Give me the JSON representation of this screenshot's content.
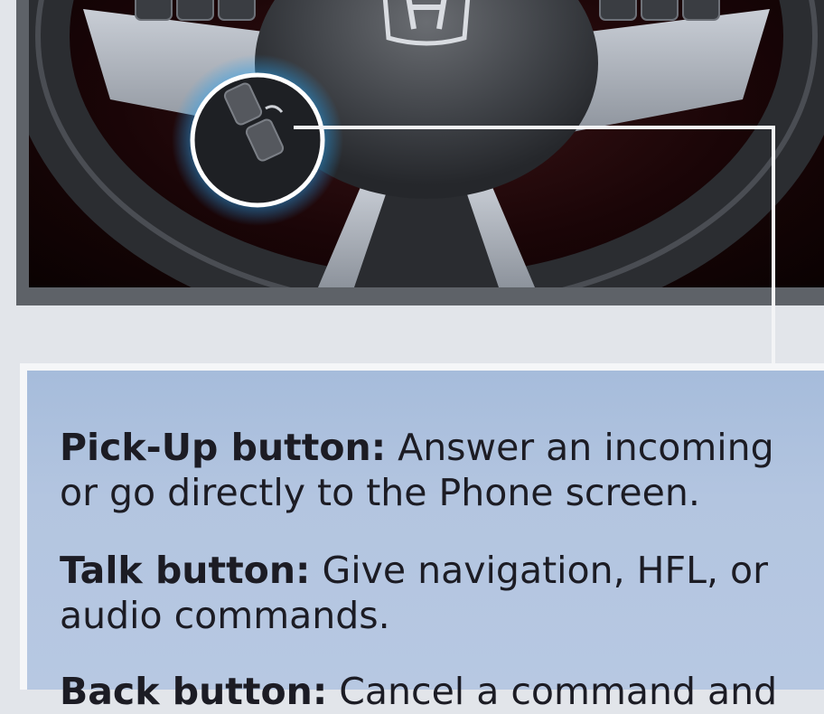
{
  "descriptions": [
    {
      "term": "Pick-Up button:",
      "line1": "Answer an incoming",
      "line2": "or go directly to the Phone screen."
    },
    {
      "term": "Talk button:",
      "line1": "Give navigation, HFL, or",
      "line2": "audio commands."
    },
    {
      "term": "Back button:",
      "line1": "Cancel a command and",
      "line2": ""
    }
  ],
  "colors": {
    "panel": "#b3c5e0",
    "highlight_ring": "#2aa3f0",
    "text": "#1c1c24"
  }
}
